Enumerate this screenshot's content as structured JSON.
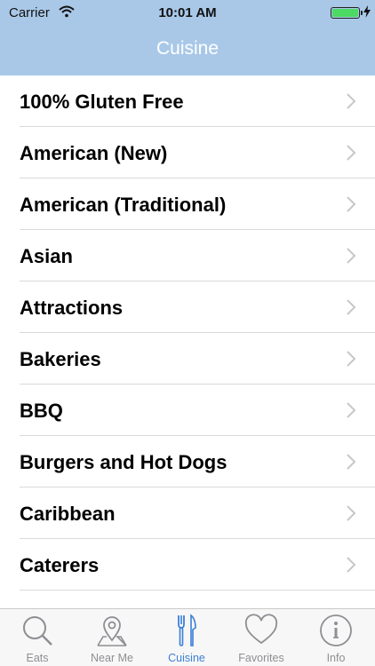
{
  "status": {
    "carrier": "Carrier",
    "time": "10:01 AM"
  },
  "nav": {
    "title": "Cuisine"
  },
  "rows": [
    {
      "label": "100% Gluten Free"
    },
    {
      "label": "American (New)"
    },
    {
      "label": "American (Traditional)"
    },
    {
      "label": "Asian"
    },
    {
      "label": "Attractions"
    },
    {
      "label": "Bakeries"
    },
    {
      "label": "BBQ"
    },
    {
      "label": "Burgers and Hot Dogs"
    },
    {
      "label": "Caribbean"
    },
    {
      "label": "Caterers"
    }
  ],
  "tabs": [
    {
      "label": "Eats",
      "icon": "search-icon",
      "active": false
    },
    {
      "label": "Near Me",
      "icon": "map-pin-icon",
      "active": false
    },
    {
      "label": "Cuisine",
      "icon": "fork-knife-icon",
      "active": true
    },
    {
      "label": "Favorites",
      "icon": "heart-icon",
      "active": false
    },
    {
      "label": "Info",
      "icon": "info-icon",
      "active": false
    }
  ],
  "colors": {
    "header": "#a9c8e8",
    "accent": "#3b7fd6",
    "inactive": "#8e8e93",
    "battery": "#4cd964"
  }
}
